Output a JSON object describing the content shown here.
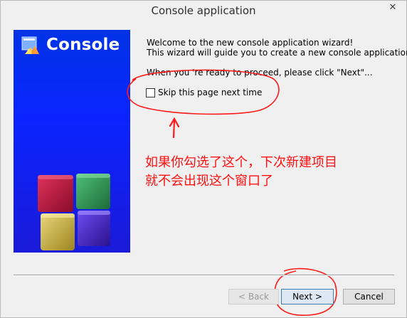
{
  "window": {
    "title": "Console application",
    "close_glyph": "✕"
  },
  "banner": {
    "title": "Console",
    "logo_icon": "codeblocks-logo-icon",
    "art_icon": "colored-cubes-icon",
    "colors": {
      "background": "#0b24ff",
      "cube_red": "#c0143c",
      "cube_green": "#2f8f4f",
      "cube_yellow": "#c8b33a",
      "cube_purple": "#4a2ad0"
    }
  },
  "content": {
    "welcome_line1": "Welcome to the new console application wizard!",
    "welcome_line2": "This wizard will guide you to create a new console application.",
    "proceed_text": "When you 're ready to proceed, please click \"Next\"...",
    "skip_checkbox": {
      "label": "Skip this page next time",
      "checked": false
    }
  },
  "annotation": {
    "line1": "如果你勾选了这个，下次新建项目",
    "line2": "就不会出现这个窗口了",
    "color": "#ff1010"
  },
  "buttons": {
    "back_label": "< Back",
    "back_enabled": false,
    "next_label": "Next >",
    "cancel_label": "Cancel"
  }
}
